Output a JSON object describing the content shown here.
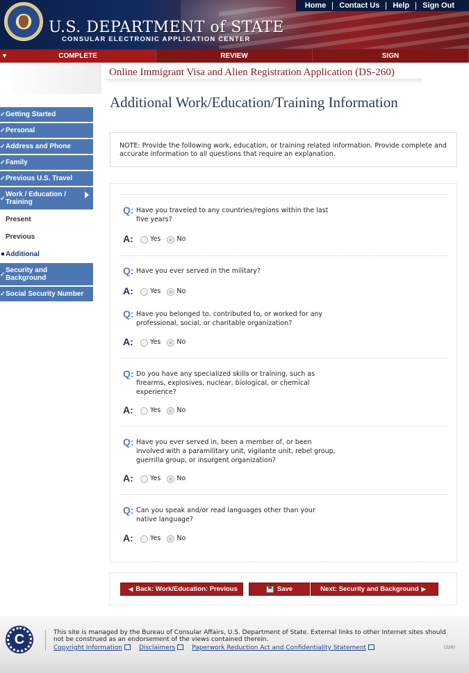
{
  "header": {
    "agency_title": "U.S. DEPARTMENT of STATE",
    "agency_subtitle": "CONSULAR ELECTRONIC APPLICATION CENTER",
    "top_links": [
      "Home",
      "Contact Us",
      "Help",
      "Sign Out"
    ]
  },
  "phases": [
    {
      "label": "COMPLETE",
      "active": true
    },
    {
      "label": "REVIEW",
      "active": false
    },
    {
      "label": "SIGN",
      "active": false
    }
  ],
  "app_title": "Online Immigrant Visa and Alien Registration Application (DS-260)",
  "sidebar": {
    "items": [
      {
        "label": "Getting Started"
      },
      {
        "label": "Personal"
      },
      {
        "label": "Address and Phone"
      },
      {
        "label": "Family"
      },
      {
        "label": "Previous U.S. Travel"
      },
      {
        "label_line1": "Work / Education /",
        "label_line2": "Training"
      }
    ],
    "sub_items": [
      "Present",
      "Previous",
      "Additional"
    ],
    "items_after": [
      {
        "label_line1": "Security and",
        "label_line2": "Background"
      },
      {
        "label": "Social Security Number"
      }
    ]
  },
  "page_title": "Additional Work/Education/Training Information",
  "note": "NOTE: Provide the following work, education, or training related information. Provide complete and accurate information to all questions that require an explanation.",
  "q_label": "Q:",
  "a_label": "A:",
  "option_yes": "Yes",
  "option_no": "No",
  "questions": [
    {
      "lines": [
        "Have you traveled to any countries/regions within the last",
        "five years?"
      ],
      "answer": "No"
    },
    {
      "lines": [
        "Have you ever served in the military?"
      ],
      "answer": "No"
    },
    {
      "lines": [
        "Have you belonged to, contributed to, or worked for any",
        "professional, social, or charitable organization?"
      ],
      "answer": "No"
    },
    {
      "lines": [
        "Do you have any specialized skills or training, such as",
        "firearms, explosives, nuclear, biological, or chemical",
        "experience?"
      ],
      "answer": "No"
    },
    {
      "lines": [
        "Have you ever served in, been a member of, or been",
        "involved with a paramilitary unit, vigilante unit, rebel group,",
        "guerrilla group, or insurgent organization?"
      ],
      "answer": "No"
    },
    {
      "lines": [
        "Can you speak and/or read languages other than your",
        "native language?"
      ],
      "answer": "No"
    }
  ],
  "buttons": {
    "back": "Back: Work/Education: Previous",
    "save": "Save",
    "next": "Next: Security and Background"
  },
  "footer": {
    "logo_letter": "C",
    "text": "This site is managed by the Bureau of Consular Affairs, U.S. Department of State. External links to other Internet sites should not be construed as an endorsement of the views contained therein.",
    "links": [
      "Copyright Information",
      "Disclaimers",
      "Paperwork Reduction Act and Confidentiality Statement"
    ],
    "code": "(226)"
  }
}
